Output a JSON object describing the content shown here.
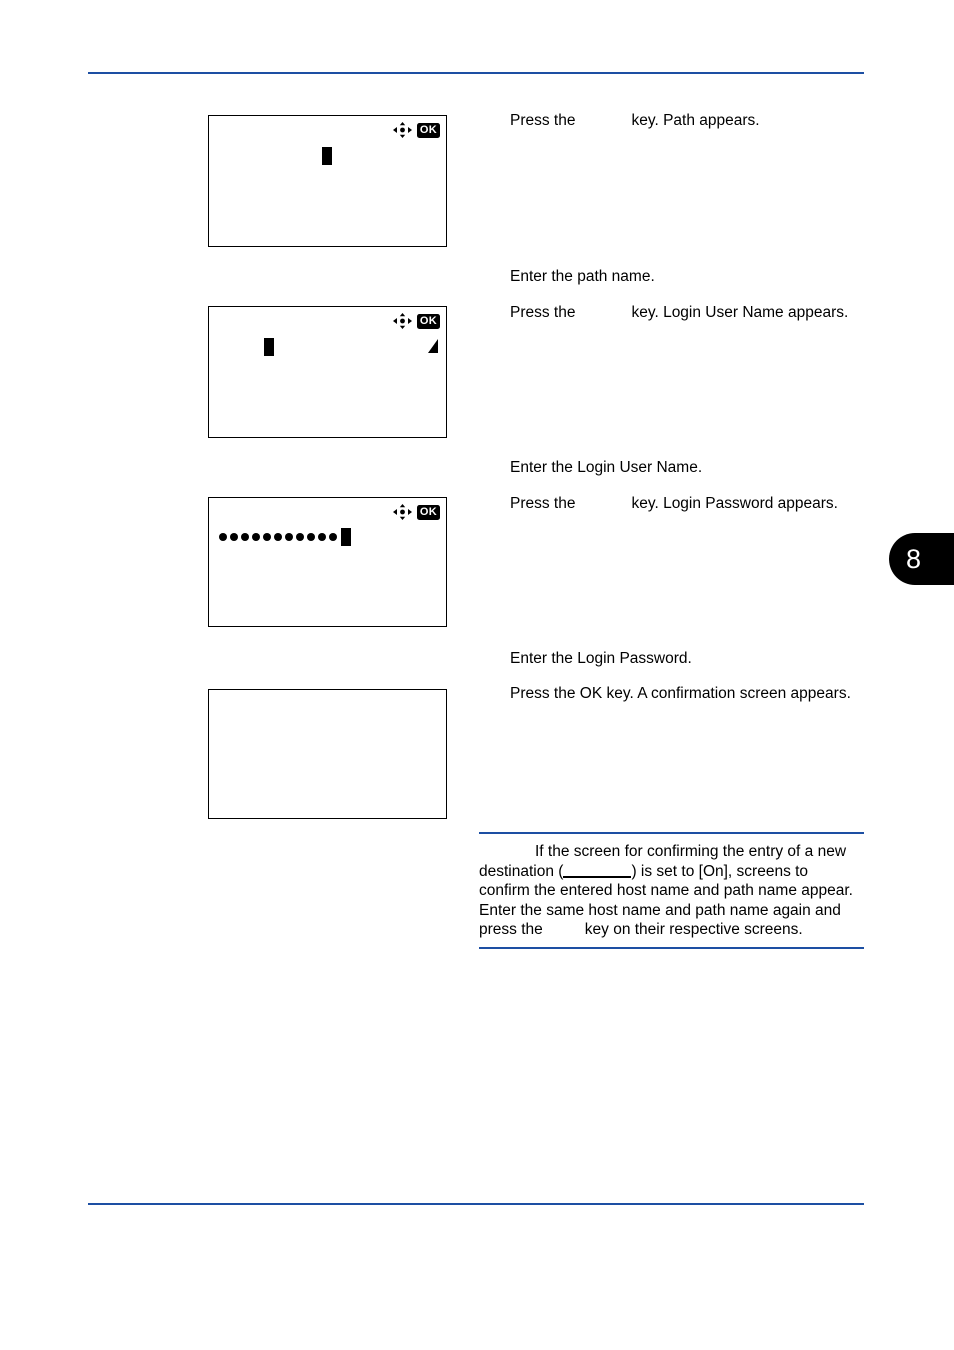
{
  "page": {
    "chapter_tab_number": "8",
    "rule_color": "#1d4fa3",
    "accent_color": "#1d4fa3"
  },
  "screens": [
    {
      "id": "path-entry-screen",
      "caption_role": "path",
      "nav_icon": "four-way-arrow-icon",
      "ok_icon_label": "OK",
      "has_cursor": true,
      "has_scroll_triangle": false,
      "masked_dots": 0
    },
    {
      "id": "login-user-name-entry-screen",
      "caption_role": "login-user-name",
      "nav_icon": "four-way-arrow-icon",
      "ok_icon_label": "OK",
      "has_cursor": true,
      "has_scroll_triangle": true,
      "masked_dots": 0
    },
    {
      "id": "login-password-entry-screen",
      "caption_role": "login-password",
      "nav_icon": "four-way-arrow-icon",
      "ok_icon_label": "OK",
      "has_cursor": true,
      "has_scroll_triangle": false,
      "masked_dots": 11
    },
    {
      "id": "confirmation-screen",
      "caption_role": "confirmation",
      "nav_icon": "",
      "ok_icon_label": "",
      "has_cursor": false,
      "has_scroll_triangle": false,
      "masked_dots": 0
    }
  ],
  "instructions": {
    "step1_prefix": "Press the",
    "step1_suffix": "key. Path appears.",
    "step2": "Enter the path name.",
    "step3_prefix": "Press the",
    "step3_suffix": "key. Login User Name appears.",
    "step4": "Enter the Login User Name.",
    "step5_prefix": "Press the",
    "step5_suffix": "key. Login Password appears.",
    "step6": "Enter the Login Password.",
    "step7": "Press the OK key. A confirmation screen appears."
  },
  "note": {
    "line1": "If the screen for confirming the entry of a new",
    "line2_before_blank": "destination (",
    "line2_after_blank": ") is set to [On], screens to",
    "line3": "confirm the entered host name and path name appear.",
    "line4": "Enter the same host name and path name again and",
    "line5_prefix": "press the",
    "line5_suffix": "key on their respective screens."
  }
}
